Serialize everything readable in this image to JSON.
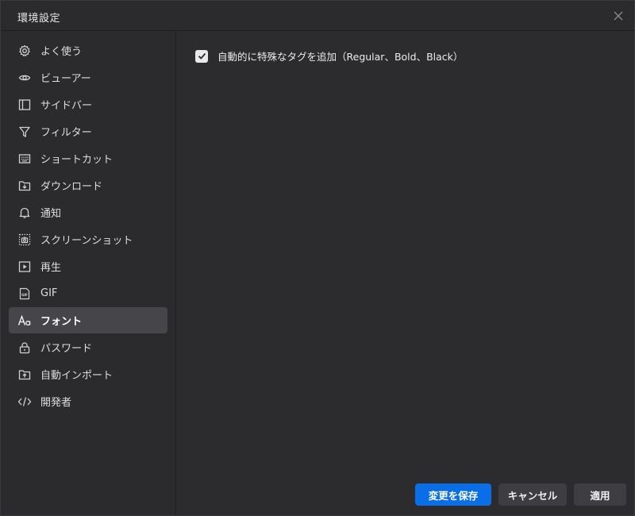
{
  "window": {
    "title": "環境設定",
    "close_icon": "close-icon"
  },
  "sidebar": {
    "items": [
      {
        "label": "よく使う",
        "icon": "gear-icon"
      },
      {
        "label": "ビューアー",
        "icon": "eye-icon"
      },
      {
        "label": "サイドバー",
        "icon": "sidebar-icon"
      },
      {
        "label": "フィルター",
        "icon": "filter-icon"
      },
      {
        "label": "ショートカット",
        "icon": "keyboard-icon"
      },
      {
        "label": "ダウンロード",
        "icon": "download-icon"
      },
      {
        "label": "通知",
        "icon": "bell-icon"
      },
      {
        "label": "スクリーンショット",
        "icon": "screenshot-icon"
      },
      {
        "label": "再生",
        "icon": "play-icon"
      },
      {
        "label": "GIF",
        "icon": "gif-icon"
      },
      {
        "label": "フォント",
        "icon": "font-icon",
        "active": true
      },
      {
        "label": "パスワード",
        "icon": "lock-icon"
      },
      {
        "label": "自動インポート",
        "icon": "import-icon"
      },
      {
        "label": "開発者",
        "icon": "code-icon"
      }
    ]
  },
  "main": {
    "auto_tag_option": {
      "label": "自動的に特殊なタグを追加（Regular、Bold、Black）",
      "checked": true
    }
  },
  "footer": {
    "save_label": "変更を保存",
    "cancel_label": "キャンセル",
    "apply_label": "適用"
  },
  "colors": {
    "accent": "#0a6ee6",
    "background": "#2c2c2f",
    "active_item": "#45454a"
  }
}
